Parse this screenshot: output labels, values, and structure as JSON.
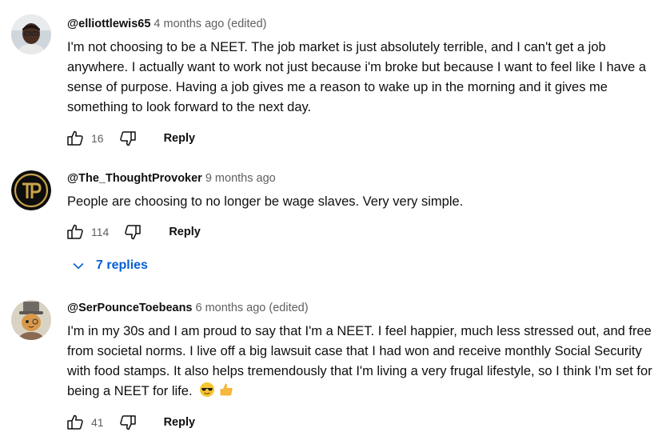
{
  "comments": [
    {
      "author": "@elliottlewis65",
      "time": "4 months ago (edited)",
      "text": "I'm not choosing to be a NEET. The job market is just absolutely terrible, and I can't get a job anywhere. I actually want to work not just because i'm broke but because I want to feel like I have a sense of purpose. Having a job gives me a reason to wake up in the morning and it gives me something to look forward to the next day.",
      "likes": "16",
      "reply_label": "Reply"
    },
    {
      "author": "@The_ThoughtProvoker",
      "time": "9 months ago",
      "text": "People are choosing to no longer be wage slaves. Very very simple.",
      "likes": "114",
      "reply_label": "Reply",
      "replies_label": "7 replies"
    },
    {
      "author": "@SerPounceToebeans",
      "time": "6 months ago (edited)",
      "text": "I'm in my 30s and I am proud to say that I'm a NEET. I feel happier, much less stressed out, and free from societal norms. I live off a big lawsuit case that I had won and receive monthly Social Security with food stamps. It also helps tremendously that I'm living a very frugal lifestyle, so I think I'm set for being a NEET for life.",
      "likes": "41",
      "reply_label": "Reply"
    }
  ],
  "colors": {
    "link_blue": "#065fd4",
    "meta_gray": "#606060",
    "avatar2_gold": "#c9a24a"
  },
  "icons": [
    "like-icon",
    "dislike-icon",
    "chevron-down-icon",
    "sunglasses-emoji",
    "thumbs-up-emoji"
  ]
}
